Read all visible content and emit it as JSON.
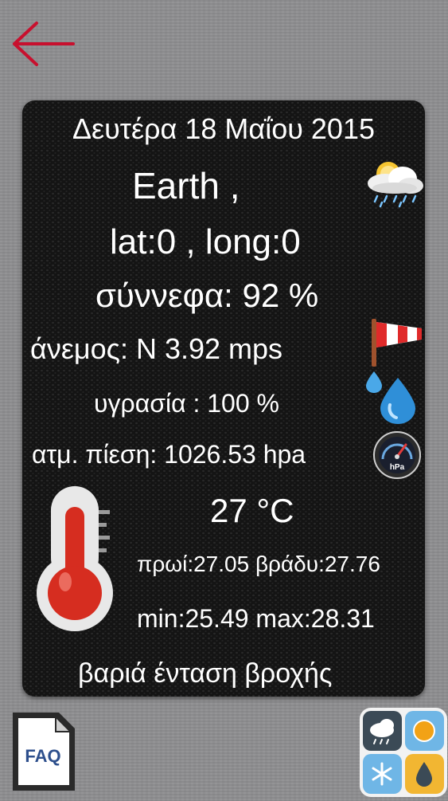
{
  "weather": {
    "date": "Δευτέρα 18 Μαΐου 2015",
    "location": "Earth ,",
    "coordinates": "lat:0 , long:0",
    "clouds": "σύννεφα:  92 %",
    "wind": "άνεμος:  N   3.92 mps",
    "humidity": "υγρασία  :  100 %",
    "pressure": "ατμ. πίεση:  1026.53 hpa",
    "pressure_icon_label": "hPa",
    "temperature": "27 °C",
    "morning_evening": "πρωί:27.05 βράδυ:27.76",
    "min_max": "min:25.49 max:28.31",
    "description": "βαριά ένταση βροχής"
  },
  "faq_label": "FAQ",
  "colors": {
    "accent_red": "#c8102e",
    "background": "#8e8e90",
    "card": "#141414",
    "text": "#ffffff"
  },
  "icons": {
    "back": "arrow-left-icon",
    "weather": "cloud-sun-rain-icon",
    "wind": "windsock-icon",
    "humidity": "water-drop-icon",
    "pressure": "barometer-gauge-icon",
    "thermometer": "thermometer-icon",
    "faq": "faq-document-icon",
    "app": "weather-tiles-icon"
  }
}
